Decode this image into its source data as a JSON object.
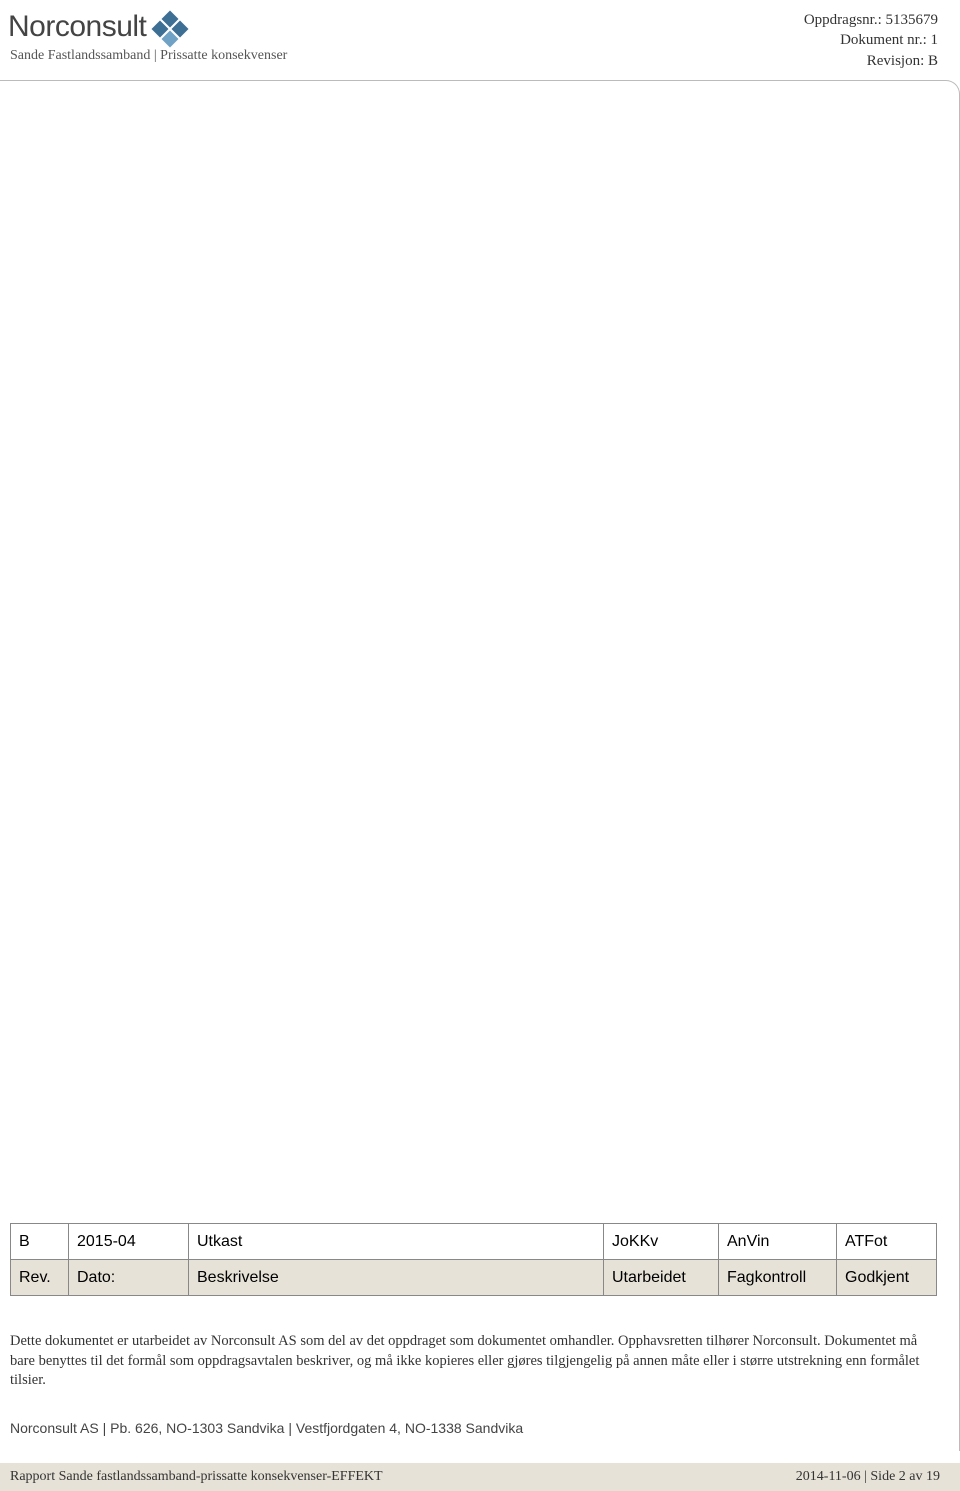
{
  "logo": {
    "name": "Norconsult"
  },
  "header": {
    "subtitle": "Sande Fastlandssamband | Prissatte konsekvenser",
    "meta": {
      "line1": "Oppdragsnr.: 5135679",
      "line2": "Dokument nr.: 1",
      "line3": "Revisjon: B"
    }
  },
  "revision_table": {
    "headers": {
      "rev": "Rev.",
      "date": "Dato:",
      "desc": "Beskrivelse",
      "utarb": "Utarbeidet",
      "fag": "Fagkontroll",
      "god": "Godkjent"
    },
    "row": {
      "rev": "B",
      "date": "2015-04",
      "desc": "Utkast",
      "utarb": "JoKKv",
      "fag": "AnVin",
      "god": "ATFot"
    }
  },
  "legal_text": "Dette dokumentet er utarbeidet av Norconsult AS som del av det oppdraget som dokumentet omhandler. Opphavsretten tilhører Norconsult. Dokumentet må bare benyttes til det formål som oppdragsavtalen beskriver, og må ikke kopieres eller gjøres tilgjengelig på annen måte eller i større utstrekning enn formålet tilsier.",
  "footer": {
    "address": "Norconsult AS | Pb. 626, NO-1303 Sandvika | Vestfjordgaten 4, NO-1338 Sandvika",
    "left": "Rapport Sande fastlandssamband-prissatte konsekvenser-EFFEKT",
    "right": "2014-11-06 | Side 2 av 19"
  }
}
